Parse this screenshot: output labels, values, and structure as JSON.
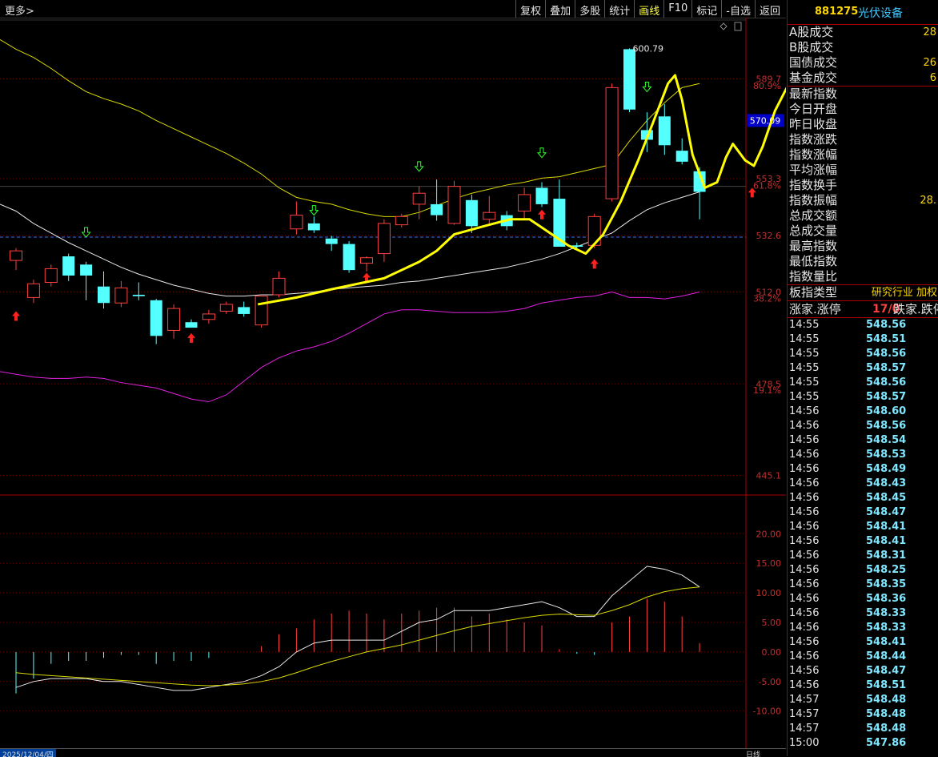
{
  "toolbar": {
    "more_label": "更多>",
    "buttons": [
      "复权",
      "叠加",
      "多股",
      "统计",
      "画线",
      "F10",
      "标记",
      "-自选",
      "返回"
    ],
    "active_button": "画线"
  },
  "index": {
    "code": "881275",
    "name": "光伏设备"
  },
  "fields": [
    {
      "label": "A股成交",
      "value": "28"
    },
    {
      "label": "B股成交",
      "value": ""
    },
    {
      "label": "国债成交",
      "value": "26"
    },
    {
      "label": "基金成交",
      "value": "6"
    },
    {
      "label": "最新指数",
      "value": ""
    },
    {
      "label": "今日开盘",
      "value": ""
    },
    {
      "label": "昨日收盘",
      "value": ""
    },
    {
      "label": "指数涨跌",
      "value": ""
    },
    {
      "label": "指数涨幅",
      "value": ""
    },
    {
      "label": "平均涨幅",
      "value": ""
    },
    {
      "label": "指数换手",
      "value": ""
    },
    {
      "label": "指数振幅",
      "value": "28."
    },
    {
      "label": "总成交额",
      "value": ""
    },
    {
      "label": "总成交量",
      "value": ""
    },
    {
      "label": "最高指数",
      "value": ""
    },
    {
      "label": "最低指数",
      "value": ""
    },
    {
      "label": "指数量比",
      "value": ""
    }
  ],
  "sector": {
    "label": "板指类型",
    "value": "研究行业 加权"
  },
  "updown": {
    "label1": "涨家.涨停",
    "value": "17/0",
    "label2": "跌家.跌停"
  },
  "ticks": [
    {
      "t": "14:55",
      "p": "548.56"
    },
    {
      "t": "14:55",
      "p": "548.51"
    },
    {
      "t": "14:55",
      "p": "548.56"
    },
    {
      "t": "14:55",
      "p": "548.57"
    },
    {
      "t": "14:55",
      "p": "548.56"
    },
    {
      "t": "14:55",
      "p": "548.57"
    },
    {
      "t": "14:56",
      "p": "548.60"
    },
    {
      "t": "14:56",
      "p": "548.56"
    },
    {
      "t": "14:56",
      "p": "548.54"
    },
    {
      "t": "14:56",
      "p": "548.53"
    },
    {
      "t": "14:56",
      "p": "548.49"
    },
    {
      "t": "14:56",
      "p": "548.43"
    },
    {
      "t": "14:56",
      "p": "548.45"
    },
    {
      "t": "14:56",
      "p": "548.47"
    },
    {
      "t": "14:56",
      "p": "548.41"
    },
    {
      "t": "14:56",
      "p": "548.41"
    },
    {
      "t": "14:56",
      "p": "548.31"
    },
    {
      "t": "14:56",
      "p": "548.25"
    },
    {
      "t": "14:56",
      "p": "548.35"
    },
    {
      "t": "14:56",
      "p": "548.36"
    },
    {
      "t": "14:56",
      "p": "548.33"
    },
    {
      "t": "14:56",
      "p": "548.33"
    },
    {
      "t": "14:56",
      "p": "548.41"
    },
    {
      "t": "14:56",
      "p": "548.44"
    },
    {
      "t": "14:56",
      "p": "548.47"
    },
    {
      "t": "14:56",
      "p": "548.51"
    },
    {
      "t": "14:57",
      "p": "548.48"
    },
    {
      "t": "14:57",
      "p": "548.48"
    },
    {
      "t": "14:57",
      "p": "548.48"
    },
    {
      "t": "15:00",
      "p": "547.86"
    }
  ],
  "price_axis": [
    "589.7",
    "553.3",
    "532.6",
    "512.0",
    "478.5",
    "445.1"
  ],
  "fib_labels": [
    "80.9%",
    "61.8%",
    "38.2%",
    "19.1%"
  ],
  "current_price_label": "570.09",
  "peak_label": "600.79",
  "macd_axis": [
    "20.00",
    "15.00",
    "10.00",
    "5.00",
    "0.00",
    "-5.00",
    "-10.00"
  ],
  "date_label": "2025/12/04/四",
  "period_label": "日线",
  "chart_data": {
    "type": "candlestick",
    "candles": [
      {
        "o": 523.5,
        "c": 527.0,
        "h": 528.0,
        "l": 520.0
      },
      {
        "o": 510.0,
        "c": 515.0,
        "h": 516.5,
        "l": 508.0
      },
      {
        "o": 515.5,
        "c": 520.5,
        "h": 522.0,
        "l": 514.0
      },
      {
        "o": 525.0,
        "c": 518.0,
        "h": 526.0,
        "l": 516.0
      },
      {
        "o": 522.0,
        "c": 518.0,
        "h": 523.0,
        "l": 509.0
      },
      {
        "o": 514.0,
        "c": 508.0,
        "h": 519.5,
        "l": 506.0
      },
      {
        "o": 508.0,
        "c": 513.5,
        "h": 516.0,
        "l": 506.5
      },
      {
        "o": 511.0,
        "c": 510.5,
        "h": 515.5,
        "l": 509.0
      },
      {
        "o": 509.0,
        "c": 496.0,
        "h": 509.5,
        "l": 493.0
      },
      {
        "o": 498.0,
        "c": 506.0,
        "h": 507.5,
        "l": 495.0
      },
      {
        "o": 501.0,
        "c": 499.0,
        "h": 502.0,
        "l": 499.0
      },
      {
        "o": 502.0,
        "c": 504.0,
        "h": 505.5,
        "l": 500.5
      },
      {
        "o": 505.0,
        "c": 507.5,
        "h": 508.5,
        "l": 504.0
      },
      {
        "o": 506.5,
        "c": 504.0,
        "h": 508.5,
        "l": 503.0
      },
      {
        "o": 500.0,
        "c": 510.5,
        "h": 510.5,
        "l": 499.0
      },
      {
        "o": 511.0,
        "c": 517.0,
        "h": 519.5,
        "l": 510.0
      },
      {
        "o": 535.0,
        "c": 540.0,
        "h": 545.0,
        "l": 533.0
      },
      {
        "o": 537.0,
        "c": 534.5,
        "h": 539.5,
        "l": 533.5
      },
      {
        "o": 531.5,
        "c": 529.5,
        "h": 532.5,
        "l": 527.0
      },
      {
        "o": 529.5,
        "c": 520.0,
        "h": 530.5,
        "l": 519.0
      },
      {
        "o": 522.5,
        "c": 524.5,
        "h": 525.0,
        "l": 519.5
      },
      {
        "o": 526.0,
        "c": 537.0,
        "h": 538.5,
        "l": 523.0
      },
      {
        "o": 536.5,
        "c": 539.5,
        "h": 540.5,
        "l": 535.5
      },
      {
        "o": 544.0,
        "c": 548.0,
        "h": 550.5,
        "l": 538.5
      },
      {
        "o": 544.0,
        "c": 540.0,
        "h": 553.0,
        "l": 538.0
      },
      {
        "o": 537.0,
        "c": 550.5,
        "h": 552.5,
        "l": 536.5
      },
      {
        "o": 545.5,
        "c": 536.0,
        "h": 547.5,
        "l": 533.5
      },
      {
        "o": 538.5,
        "c": 541.0,
        "h": 547.0,
        "l": 537.0
      },
      {
        "o": 540.0,
        "c": 536.0,
        "h": 541.5,
        "l": 534.5
      },
      {
        "o": 541.5,
        "c": 547.5,
        "h": 550.0,
        "l": 538.5
      },
      {
        "o": 550.0,
        "c": 544.0,
        "h": 552.0,
        "l": 543.0
      },
      {
        "o": 546.0,
        "c": 528.5,
        "h": 553.0,
        "l": 528.5
      },
      {
        "o": 529.0,
        "c": 528.5,
        "h": 530.0,
        "l": 527.5
      },
      {
        "o": 529.0,
        "c": 539.5,
        "h": 540.5,
        "l": 528.0
      },
      {
        "o": 546.0,
        "c": 586.5,
        "h": 588.0,
        "l": 545.0
      },
      {
        "o": 600.5,
        "c": 578.5,
        "h": 600.8,
        "l": 577.5
      },
      {
        "o": 571.0,
        "c": 567.5,
        "h": 577.5,
        "l": 563.0
      },
      {
        "o": 576.0,
        "c": 565.5,
        "h": 580.5,
        "l": 562.0
      },
      {
        "o": 563.5,
        "c": 559.5,
        "h": 568.0,
        "l": 558.5
      },
      {
        "o": 556.0,
        "c": 548.5,
        "h": 557.5,
        "l": 538.5
      }
    ],
    "upper_band": [
      600.5,
      597.5,
      593.5,
      589.0,
      585.0,
      582.5,
      580.5,
      578.0,
      574.5,
      571.5,
      568.5,
      565.5,
      562.5,
      559.0,
      555.0,
      550.0,
      546.5,
      545.0,
      544.0,
      542.0,
      540.5,
      539.5,
      539.5,
      541.0,
      543.5,
      546.0,
      548.0,
      549.5,
      551.0,
      552.0,
      553.5,
      554.0,
      555.5,
      557.0,
      558.5,
      567.0,
      574.5,
      581.0,
      586.5,
      588.0
    ],
    "mid_band": [
      541.5,
      537.0,
      533.5,
      530.0,
      527.0,
      524.0,
      521.0,
      518.5,
      516.5,
      514.5,
      513.0,
      511.5,
      510.5,
      510.5,
      511.0,
      511.0,
      511.5,
      512.0,
      513.0,
      513.5,
      514.0,
      514.5,
      515.5,
      516.0,
      517.0,
      518.0,
      519.0,
      520.0,
      521.0,
      522.5,
      524.0,
      526.0,
      528.5,
      531.0,
      533.5,
      538.0,
      542.0,
      544.5,
      546.5,
      548.5
    ],
    "lower_band": [
      482.0,
      481.0,
      480.5,
      480.5,
      481.0,
      480.5,
      479.0,
      478.0,
      477.0,
      475.0,
      473.0,
      472.0,
      474.5,
      479.5,
      484.5,
      488.0,
      490.5,
      492.0,
      494.0,
      497.0,
      500.5,
      504.0,
      505.5,
      505.5,
      505.0,
      504.5,
      504.5,
      504.5,
      505.0,
      506.0,
      508.0,
      509.0,
      510.0,
      510.5,
      512.0,
      510.0,
      510.0,
      509.5,
      510.5,
      512.0
    ],
    "drawn_line": [
      [
        13.8,
        507.5
      ],
      [
        16,
        510
      ],
      [
        18,
        513
      ],
      [
        21,
        517
      ],
      [
        23,
        523
      ],
      [
        24,
        527
      ],
      [
        25,
        533
      ],
      [
        27,
        536.5
      ],
      [
        28.2,
        538.5
      ],
      [
        29.3,
        538.5
      ],
      [
        30,
        535.5
      ],
      [
        31.5,
        529
      ],
      [
        32.5,
        526
      ],
      [
        33.5,
        533
      ],
      [
        34.5,
        545
      ],
      [
        35.5,
        560
      ],
      [
        36.3,
        573
      ],
      [
        37.2,
        588
      ],
      [
        37.6,
        591
      ],
      [
        38,
        582
      ],
      [
        38.6,
        562
      ],
      [
        39.3,
        550
      ],
      [
        40,
        552
      ],
      [
        40.5,
        561
      ],
      [
        40.9,
        566
      ],
      [
        41.6,
        560
      ],
      [
        42.1,
        558
      ],
      [
        42.6,
        565
      ],
      [
        43.3,
        578
      ],
      [
        44.1,
        588
      ]
    ],
    "macd_bars": [
      -7,
      -4.5,
      -2,
      -1.5,
      -1.5,
      -1.0,
      -0.5,
      -0.5,
      -2.0,
      -1.5,
      -1.5,
      -1.0,
      0.0,
      0.0,
      1.0,
      3.0,
      4.0,
      5.5,
      6.5,
      7.0,
      6.5,
      5.5,
      6.5,
      7.0,
      7.5,
      7.5,
      6.0,
      6.5,
      5.5,
      5.0,
      4.5,
      0.5,
      -0.3,
      -0.5,
      5.0,
      6.0,
      9.0,
      8.5,
      6.0,
      1.5
    ],
    "dif": [
      -6.0,
      -5.0,
      -4.5,
      -4.5,
      -4.5,
      -5.0,
      -5.0,
      -5.5,
      -6.0,
      -6.5,
      -6.5,
      -6.0,
      -5.5,
      -5.0,
      -4.0,
      -2.5,
      0.0,
      1.5,
      2.0,
      2.0,
      2.0,
      2.0,
      3.5,
      5.0,
      5.5,
      7.0,
      7.0,
      7.0,
      7.5,
      8.0,
      8.5,
      7.5,
      6.0,
      6.0,
      9.5,
      12.0,
      14.5,
      14.0,
      13.0,
      11.0
    ],
    "dea": [
      -3.5,
      -3.8,
      -4.0,
      -4.2,
      -4.4,
      -4.6,
      -4.8,
      -5.0,
      -5.2,
      -5.4,
      -5.6,
      -5.7,
      -5.6,
      -5.4,
      -5.0,
      -4.4,
      -3.5,
      -2.5,
      -1.6,
      -0.8,
      0.0,
      0.6,
      1.2,
      2.0,
      2.8,
      3.6,
      4.3,
      4.8,
      5.3,
      5.8,
      6.2,
      6.4,
      6.3,
      6.2,
      7.0,
      8.0,
      9.3,
      10.2,
      10.7,
      11.0
    ]
  }
}
